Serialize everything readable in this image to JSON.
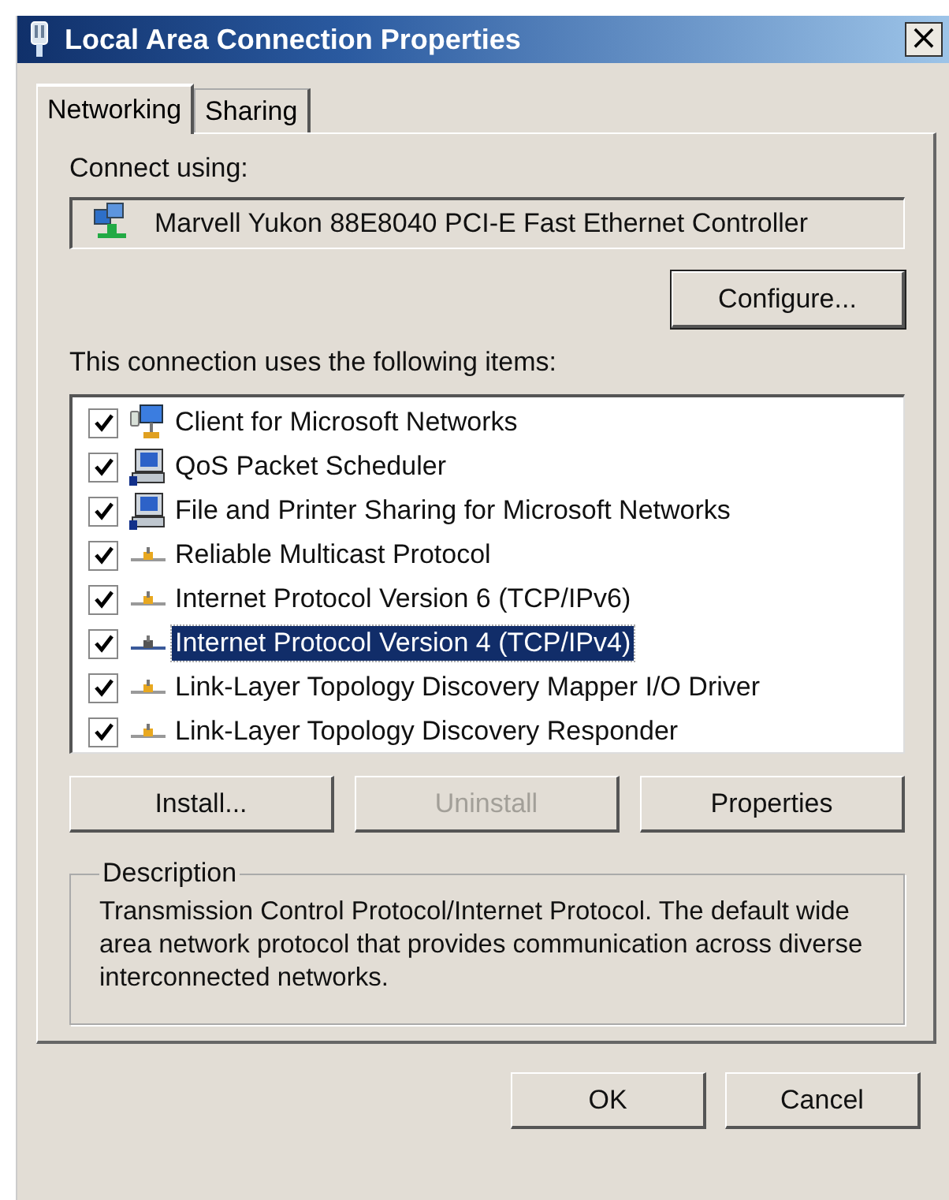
{
  "window": {
    "title": "Local Area Connection Properties",
    "close": "×"
  },
  "tabs": [
    {
      "label": "Networking",
      "selected": true
    },
    {
      "label": "Sharing",
      "selected": false
    }
  ],
  "connect_using": {
    "label": "Connect using:",
    "adapter": "Marvell Yukon 88E8040 PCI-E Fast Ethernet Controller",
    "configure": "Configure..."
  },
  "items_label": "This connection uses the following items:",
  "items": [
    {
      "label": "Client for Microsoft Networks",
      "kind": "client",
      "checked": true,
      "selected": false
    },
    {
      "label": "QoS Packet Scheduler",
      "kind": "service",
      "checked": true,
      "selected": false
    },
    {
      "label": "File and Printer Sharing for Microsoft Networks",
      "kind": "service",
      "checked": true,
      "selected": false
    },
    {
      "label": "Reliable Multicast Protocol",
      "kind": "protocol",
      "checked": true,
      "selected": false
    },
    {
      "label": "Internet Protocol Version 6 (TCP/IPv6)",
      "kind": "protocol",
      "checked": true,
      "selected": false
    },
    {
      "label": "Internet Protocol Version 4 (TCP/IPv4)",
      "kind": "protocol",
      "checked": true,
      "selected": true
    },
    {
      "label": "Link-Layer Topology Discovery Mapper I/O Driver",
      "kind": "protocol",
      "checked": true,
      "selected": false
    },
    {
      "label": "Link-Layer Topology Discovery Responder",
      "kind": "protocol",
      "checked": true,
      "selected": false
    }
  ],
  "item_buttons": [
    {
      "label": "Install...",
      "disabled": false
    },
    {
      "label": "Uninstall",
      "disabled": true
    },
    {
      "label": "Properties",
      "disabled": false
    }
  ],
  "description": {
    "title": "Description",
    "text": "Transmission Control Protocol/Internet Protocol. The default wide area network protocol that provides communication across diverse interconnected networks."
  },
  "buttons": [
    "OK",
    "Cancel"
  ]
}
